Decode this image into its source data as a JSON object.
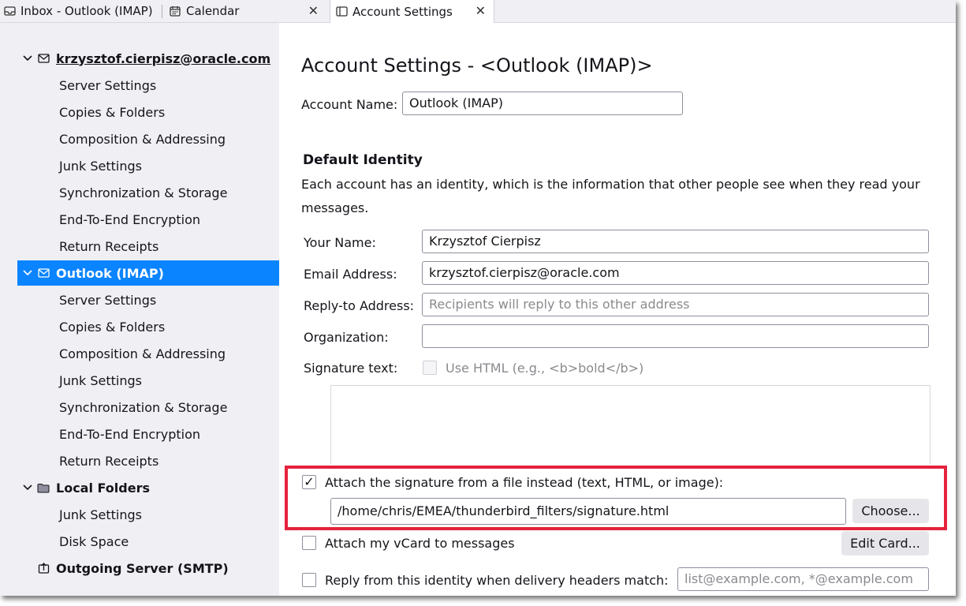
{
  "tabs": [
    {
      "label": "Inbox - Outlook (IMAP)",
      "icon": "inbox-icon"
    },
    {
      "label": "Calendar",
      "icon": "calendar-icon"
    },
    {
      "label": "Account Settings",
      "icon": "settings-page-icon"
    }
  ],
  "sidebar": {
    "accounts": [
      {
        "name": "krzysztof.cierpisz@oracle.com",
        "items": [
          "Server Settings",
          "Copies & Folders",
          "Composition & Addressing",
          "Junk Settings",
          "Synchronization & Storage",
          "End-To-End Encryption",
          "Return Receipts"
        ]
      },
      {
        "name": "Outlook (IMAP)",
        "items": [
          "Server Settings",
          "Copies & Folders",
          "Composition & Addressing",
          "Junk Settings",
          "Synchronization & Storage",
          "End-To-End Encryption",
          "Return Receipts"
        ]
      },
      {
        "name": "Local Folders",
        "items": [
          "Junk Settings",
          "Disk Space"
        ]
      }
    ],
    "outgoing": "Outgoing Server (SMTP)"
  },
  "main": {
    "title": "Account Settings - <Outlook (IMAP)>",
    "account_name_label": "Account Name:",
    "account_name_value": "Outlook (IMAP)",
    "default_identity_heading": "Default Identity",
    "identity_description": "Each account has an identity, which is the information that other people see when they read your messages.",
    "your_name_label": "Your Name:",
    "your_name_value": "Krzysztof Cierpisz",
    "email_label": "Email Address:",
    "email_value": "krzysztof.cierpisz@oracle.com",
    "reply_to_label": "Reply-to Address:",
    "reply_to_placeholder": "Recipients will reply to this other address",
    "organization_label": "Organization:",
    "organization_value": "",
    "signature_label": "Signature text:",
    "use_html_label": "Use HTML (e.g., <b>bold</b>)",
    "attach_signature_label": "Attach the signature from a file instead (text, HTML, or image):",
    "signature_path": "/home/chris/EMEA/thunderbird_filters/signature.html",
    "choose_button": "Choose...",
    "attach_vcard_label": "Attach my vCard to messages",
    "edit_card_button": "Edit Card...",
    "reply_identity_label": "Reply from this identity when delivery headers match:",
    "reply_identity_placeholder": "list@example.com, *@example.com"
  },
  "colors": {
    "selection": "#0a84ff",
    "highlight": "#e5223c",
    "sidebar_bg": "#f0f0f4"
  }
}
